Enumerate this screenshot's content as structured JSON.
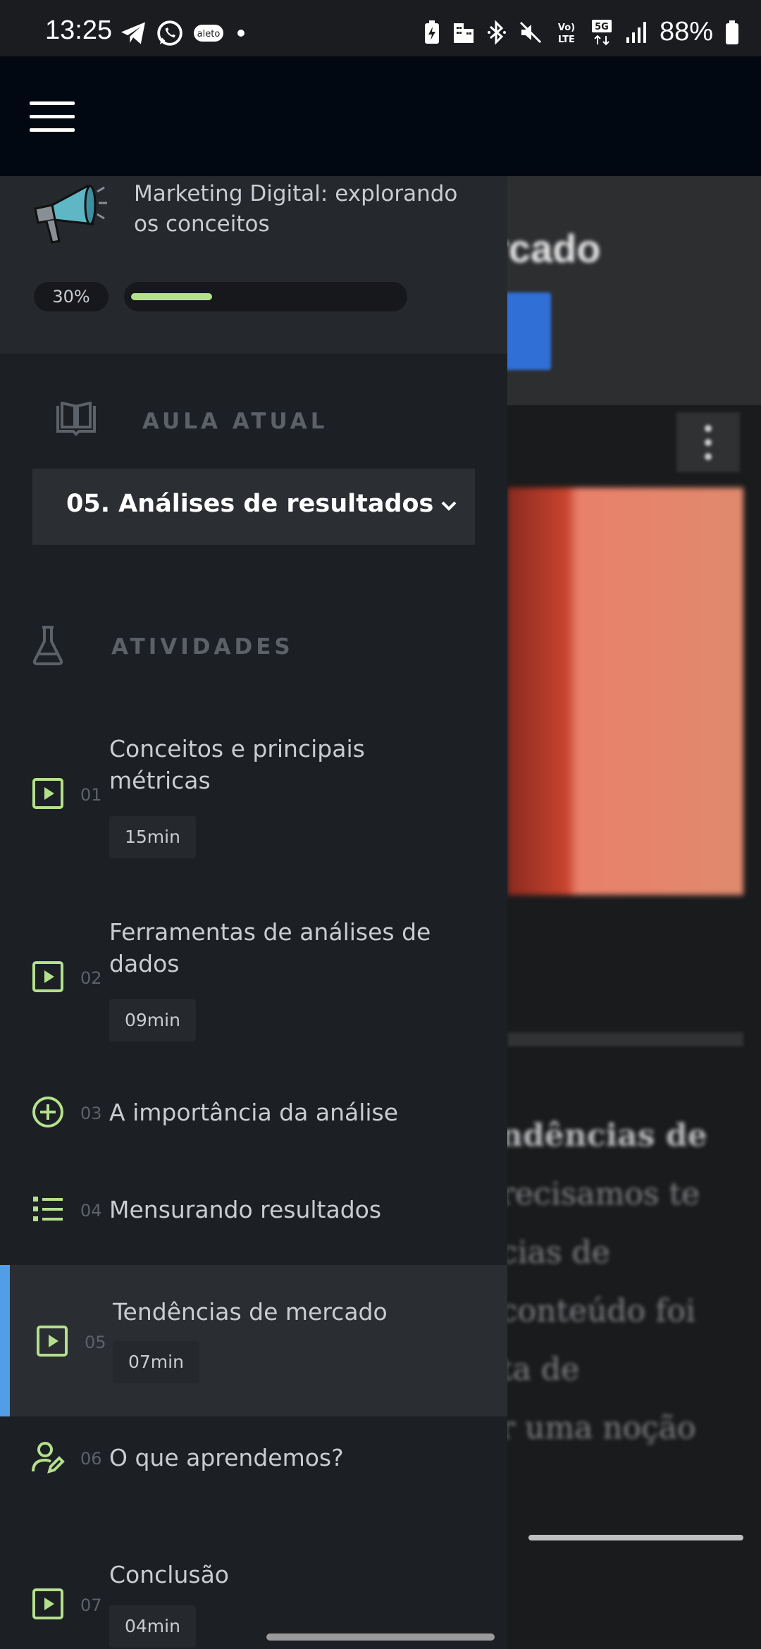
{
  "status_bar": {
    "time": "13:25",
    "left_icons": [
      "telegram-icon",
      "whatsapp-icon",
      "aleto-icon",
      "dot-icon"
    ],
    "right_icons": [
      "battery-saver-icon",
      "building-icon",
      "bluetooth-icon",
      "mute-icon",
      "volte-icon",
      "5g-icon",
      "signal-icon"
    ],
    "battery": "88%"
  },
  "app_bar": {
    "menu_icon": "hamburger-menu-icon"
  },
  "drawer": {
    "course": {
      "title": "Marketing Digital: explorando os conceitos",
      "progress_label": "30%",
      "progress_value": 0.3
    },
    "current_lesson": {
      "section_label": "AULA ATUAL",
      "selected": "05. Análises de resultados"
    },
    "activities": {
      "section_label": "ATIVIDADES",
      "items": [
        {
          "num": "01",
          "title": "Conceitos e principais métricas",
          "duration": "15min",
          "icon": "video-play-icon"
        },
        {
          "num": "02",
          "title": "Ferramentas de análises de dados",
          "duration": "09min",
          "icon": "video-play-icon"
        },
        {
          "num": "03",
          "title": "A importância da análise",
          "icon": "plus-circle-icon"
        },
        {
          "num": "04",
          "title": "Mensurando resultados",
          "icon": "list-icon"
        },
        {
          "num": "05",
          "title": "Tendências de mercado",
          "duration": "07min",
          "icon": "video-play-icon",
          "active": true
        },
        {
          "num": "06",
          "title": "O que aprendemos?",
          "icon": "user-edit-icon"
        },
        {
          "num": "07",
          "title": "Conclusão",
          "duration": "04min",
          "icon": "video-play-icon"
        }
      ]
    }
  },
  "background": {
    "title_fragment": "rcado",
    "text_lines": [
      "ndências de",
      "recisamos te",
      "cias de",
      "conteúdo foi",
      "ta de",
      "r uma noção"
    ]
  },
  "colors": {
    "accent_green": "#b4e08c",
    "active_bar": "#4f9ee6",
    "drawer_bg": "#1c1f23"
  }
}
